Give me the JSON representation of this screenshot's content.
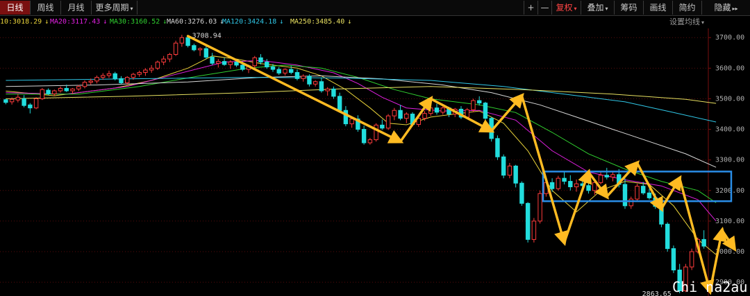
{
  "toolbar": {
    "tabs": [
      "日线",
      "周线",
      "月线",
      "更多周期"
    ],
    "right_buttons": [
      "+",
      "—",
      "复权",
      "叠加",
      "筹码",
      "画线",
      "简约",
      "隐藏"
    ]
  },
  "ma_bar": {
    "items": [
      {
        "label": "10:3018.29",
        "color": "#e8d23a"
      },
      {
        "label": "MA20:3117.43",
        "color": "#e020e0"
      },
      {
        "label": "MA30:3160.52",
        "color": "#30d030"
      },
      {
        "label": "MA60:3276.03",
        "color": "#d8d8d8"
      },
      {
        "label": "MA120:3424.18",
        "color": "#30c8e8"
      },
      {
        "label": "MA250:3485.40",
        "color": "#e8e060"
      }
    ],
    "settings_label": "设置均线"
  },
  "annotations": {
    "high_label": "3708.94",
    "low_label": "2863.65",
    "watermark": "Chi na2au"
  },
  "colors": {
    "up": "#ff3c3c",
    "down": "#22dddd",
    "arrow": "#ffbb22",
    "box": "#2a8ee8"
  },
  "chart_data": {
    "type": "candlestick",
    "y_ticks": [
      2900,
      3000,
      3100,
      3200,
      3300,
      3400,
      3500,
      3600,
      3700
    ],
    "ylim": [
      2855,
      3730
    ],
    "grid": true,
    "highest": 3708.94,
    "lowest": 2863.65,
    "ohlc": [
      [
        3497,
        3500,
        3482,
        3488
      ],
      [
        3490,
        3504,
        3481,
        3498
      ],
      [
        3496,
        3515,
        3488,
        3505
      ],
      [
        3500,
        3512,
        3472,
        3478
      ],
      [
        3480,
        3486,
        3452,
        3470
      ],
      [
        3470,
        3505,
        3466,
        3500
      ],
      [
        3500,
        3535,
        3496,
        3530
      ],
      [
        3528,
        3534,
        3512,
        3516
      ],
      [
        3516,
        3530,
        3510,
        3526
      ],
      [
        3526,
        3540,
        3520,
        3534
      ],
      [
        3534,
        3546,
        3522,
        3526
      ],
      [
        3526,
        3535,
        3516,
        3532
      ],
      [
        3532,
        3545,
        3525,
        3540
      ],
      [
        3540,
        3560,
        3534,
        3554
      ],
      [
        3554,
        3566,
        3546,
        3558
      ],
      [
        3558,
        3576,
        3550,
        3570
      ],
      [
        3570,
        3584,
        3562,
        3576
      ],
      [
        3576,
        3592,
        3568,
        3582
      ],
      [
        3582,
        3588,
        3560,
        3566
      ],
      [
        3566,
        3574,
        3548,
        3552
      ],
      [
        3552,
        3574,
        3546,
        3570
      ],
      [
        3570,
        3585,
        3562,
        3580
      ],
      [
        3580,
        3592,
        3572,
        3586
      ],
      [
        3586,
        3600,
        3575,
        3594
      ],
      [
        3594,
        3610,
        3585,
        3600
      ],
      [
        3600,
        3625,
        3594,
        3620
      ],
      [
        3620,
        3640,
        3610,
        3630
      ],
      [
        3630,
        3650,
        3620,
        3645
      ],
      [
        3645,
        3690,
        3640,
        3682
      ],
      [
        3682,
        3709,
        3670,
        3700
      ],
      [
        3700,
        3708,
        3668,
        3674
      ],
      [
        3674,
        3680,
        3655,
        3660
      ],
      [
        3660,
        3668,
        3640,
        3664
      ],
      [
        3664,
        3672,
        3630,
        3636
      ],
      [
        3636,
        3650,
        3610,
        3616
      ],
      [
        3616,
        3630,
        3602,
        3622
      ],
      [
        3622,
        3634,
        3608,
        3612
      ],
      [
        3612,
        3626,
        3598,
        3620
      ],
      [
        3620,
        3630,
        3604,
        3610
      ],
      [
        3610,
        3622,
        3590,
        3596
      ],
      [
        3596,
        3612,
        3584,
        3608
      ],
      [
        3608,
        3640,
        3600,
        3634
      ],
      [
        3634,
        3646,
        3612,
        3620
      ],
      [
        3620,
        3630,
        3598,
        3604
      ],
      [
        3604,
        3614,
        3588,
        3596
      ],
      [
        3596,
        3604,
        3578,
        3584
      ],
      [
        3584,
        3600,
        3576,
        3596
      ],
      [
        3596,
        3608,
        3580,
        3586
      ],
      [
        3586,
        3596,
        3560,
        3566
      ],
      [
        3566,
        3580,
        3556,
        3574
      ],
      [
        3574,
        3580,
        3540,
        3548
      ],
      [
        3548,
        3560,
        3540,
        3556
      ],
      [
        3556,
        3570,
        3520,
        3526
      ],
      [
        3526,
        3538,
        3510,
        3532
      ],
      [
        3532,
        3540,
        3500,
        3508
      ],
      [
        3508,
        3520,
        3455,
        3462
      ],
      [
        3462,
        3476,
        3410,
        3418
      ],
      [
        3418,
        3440,
        3405,
        3434
      ],
      [
        3434,
        3446,
        3392,
        3400
      ],
      [
        3400,
        3412,
        3350,
        3356
      ],
      [
        3356,
        3372,
        3350,
        3366
      ],
      [
        3366,
        3420,
        3360,
        3414
      ],
      [
        3414,
        3432,
        3398,
        3404
      ],
      [
        3404,
        3450,
        3398,
        3444
      ],
      [
        3444,
        3470,
        3430,
        3462
      ],
      [
        3462,
        3480,
        3430,
        3436
      ],
      [
        3436,
        3456,
        3420,
        3450
      ],
      [
        3450,
        3456,
        3410,
        3416
      ],
      [
        3416,
        3440,
        3408,
        3436
      ],
      [
        3436,
        3460,
        3428,
        3452
      ],
      [
        3452,
        3476,
        3444,
        3470
      ],
      [
        3470,
        3484,
        3448,
        3456
      ],
      [
        3456,
        3476,
        3448,
        3470
      ],
      [
        3470,
        3474,
        3440,
        3450
      ],
      [
        3450,
        3470,
        3440,
        3466
      ],
      [
        3466,
        3476,
        3434,
        3440
      ],
      [
        3440,
        3470,
        3434,
        3464
      ],
      [
        3464,
        3500,
        3456,
        3494
      ],
      [
        3494,
        3508,
        3478,
        3486
      ],
      [
        3486,
        3490,
        3430,
        3436
      ],
      [
        3436,
        3440,
        3360,
        3370
      ],
      [
        3370,
        3380,
        3300,
        3310
      ],
      [
        3310,
        3318,
        3240,
        3250
      ],
      [
        3250,
        3290,
        3240,
        3280
      ],
      [
        3280,
        3284,
        3210,
        3224
      ],
      [
        3224,
        3230,
        3150,
        3158
      ],
      [
        3158,
        3162,
        3030,
        3040
      ],
      [
        3040,
        3110,
        3030,
        3100
      ],
      [
        3100,
        3200,
        3092,
        3190
      ],
      [
        3190,
        3236,
        3180,
        3226
      ],
      [
        3226,
        3240,
        3196,
        3206
      ],
      [
        3206,
        3248,
        3200,
        3240
      ],
      [
        3240,
        3262,
        3220,
        3230
      ],
      [
        3230,
        3250,
        3200,
        3212
      ],
      [
        3212,
        3236,
        3196,
        3222
      ],
      [
        3222,
        3246,
        3206,
        3216
      ],
      [
        3216,
        3240,
        3190,
        3200
      ],
      [
        3200,
        3234,
        3186,
        3226
      ],
      [
        3226,
        3262,
        3220,
        3250
      ],
      [
        3250,
        3274,
        3236,
        3244
      ],
      [
        3244,
        3262,
        3230,
        3252
      ],
      [
        3252,
        3270,
        3210,
        3220
      ],
      [
        3220,
        3240,
        3140,
        3150
      ],
      [
        3150,
        3180,
        3140,
        3172
      ],
      [
        3172,
        3222,
        3166,
        3214
      ],
      [
        3214,
        3228,
        3186,
        3192
      ],
      [
        3192,
        3206,
        3170,
        3176
      ],
      [
        3176,
        3190,
        3140,
        3148
      ],
      [
        3148,
        3156,
        3080,
        3090
      ],
      [
        3090,
        3096,
        3000,
        3010
      ],
      [
        3010,
        3020,
        2930,
        2940
      ],
      [
        2940,
        2960,
        2864,
        2872
      ],
      [
        2872,
        2960,
        2868,
        2950
      ],
      [
        2950,
        3010,
        2940,
        3000
      ],
      [
        3000,
        3046,
        2994,
        3040
      ],
      [
        3040,
        3070,
        3010,
        3018
      ]
    ],
    "series": [
      {
        "name": "MA10",
        "color": "#e8d23a",
        "points": [
          [
            3525,
            0
          ],
          [
            3510,
            8
          ],
          [
            3535,
            18
          ],
          [
            3560,
            24
          ],
          [
            3600,
            30
          ],
          [
            3640,
            34
          ],
          [
            3630,
            38
          ],
          [
            3615,
            42
          ],
          [
            3600,
            48
          ],
          [
            3575,
            52
          ],
          [
            3530,
            56
          ],
          [
            3470,
            60
          ],
          [
            3420,
            63
          ],
          [
            3415,
            66
          ],
          [
            3440,
            70
          ],
          [
            3450,
            74
          ],
          [
            3460,
            78
          ],
          [
            3420,
            82
          ],
          [
            3330,
            86
          ],
          [
            3200,
            90
          ],
          [
            3130,
            94
          ],
          [
            3200,
            98
          ],
          [
            3230,
            102
          ],
          [
            3220,
            106
          ],
          [
            3150,
            110
          ],
          [
            3040,
            114
          ],
          [
            2990,
            117
          ]
        ]
      },
      {
        "name": "MA20",
        "color": "#e020e0",
        "points": [
          [
            3520,
            0
          ],
          [
            3515,
            10
          ],
          [
            3540,
            20
          ],
          [
            3580,
            28
          ],
          [
            3620,
            36
          ],
          [
            3625,
            42
          ],
          [
            3610,
            48
          ],
          [
            3585,
            54
          ],
          [
            3550,
            58
          ],
          [
            3505,
            62
          ],
          [
            3470,
            66
          ],
          [
            3460,
            72
          ],
          [
            3462,
            78
          ],
          [
            3430,
            84
          ],
          [
            3330,
            90
          ],
          [
            3260,
            96
          ],
          [
            3235,
            102
          ],
          [
            3215,
            108
          ],
          [
            3170,
            114
          ],
          [
            3100,
            117
          ]
        ]
      },
      {
        "name": "MA30",
        "color": "#30d030",
        "points": [
          [
            3515,
            0
          ],
          [
            3515,
            12
          ],
          [
            3540,
            22
          ],
          [
            3575,
            32
          ],
          [
            3600,
            40
          ],
          [
            3610,
            46
          ],
          [
            3600,
            52
          ],
          [
            3570,
            58
          ],
          [
            3530,
            64
          ],
          [
            3500,
            70
          ],
          [
            3480,
            78
          ],
          [
            3455,
            84
          ],
          [
            3390,
            90
          ],
          [
            3320,
            96
          ],
          [
            3270,
            102
          ],
          [
            3230,
            108
          ],
          [
            3200,
            114
          ],
          [
            3160,
            117
          ]
        ]
      },
      {
        "name": "MA60",
        "color": "#d8d8d8",
        "points": [
          [
            3540,
            0
          ],
          [
            3545,
            15
          ],
          [
            3555,
            30
          ],
          [
            3570,
            42
          ],
          [
            3575,
            52
          ],
          [
            3565,
            62
          ],
          [
            3545,
            72
          ],
          [
            3520,
            80
          ],
          [
            3480,
            88
          ],
          [
            3440,
            94
          ],
          [
            3400,
            100
          ],
          [
            3360,
            106
          ],
          [
            3320,
            112
          ],
          [
            3276,
            117
          ]
        ]
      },
      {
        "name": "MA120",
        "color": "#30c8e8",
        "points": [
          [
            3560,
            0
          ],
          [
            3565,
            20
          ],
          [
            3570,
            40
          ],
          [
            3568,
            55
          ],
          [
            3560,
            70
          ],
          [
            3540,
            82
          ],
          [
            3515,
            92
          ],
          [
            3490,
            102
          ],
          [
            3455,
            110
          ],
          [
            3424,
            117
          ]
        ]
      },
      {
        "name": "MA250",
        "color": "#e8e060",
        "points": [
          [
            3500,
            0
          ],
          [
            3508,
            20
          ],
          [
            3520,
            40
          ],
          [
            3532,
            55
          ],
          [
            3540,
            70
          ],
          [
            3530,
            85
          ],
          [
            3515,
            100
          ],
          [
            3498,
            112
          ],
          [
            3485,
            117
          ]
        ]
      }
    ],
    "trend_arrows": [
      [
        [
          3705,
          30
        ],
        [
          3360,
          65
        ]
      ],
      [
        [
          3360,
          65
        ],
        [
          3500,
          70
        ]
      ],
      [
        [
          3500,
          70
        ],
        [
          3395,
          80
        ]
      ],
      [
        [
          3395,
          80
        ],
        [
          3510,
          85
        ]
      ],
      [
        [
          3510,
          85
        ],
        [
          3030,
          92
        ]
      ],
      [
        [
          3030,
          92
        ],
        [
          3260,
          96
        ]
      ],
      [
        [
          3260,
          96
        ],
        [
          3180,
          99
        ]
      ],
      [
        [
          3180,
          99
        ],
        [
          3290,
          104
        ]
      ],
      [
        [
          3290,
          104
        ],
        [
          3140,
          108
        ]
      ],
      [
        [
          3140,
          108
        ],
        [
          3240,
          111
        ]
      ],
      [
        [
          3240,
          111
        ],
        [
          2870,
          116
        ]
      ],
      [
        [
          2870,
          116
        ],
        [
          3070,
          118
        ]
      ],
      [
        [
          3070,
          118
        ],
        [
          3010,
          120
        ]
      ]
    ],
    "highlight_box": {
      "y_top": 3262,
      "y_bottom": 3165,
      "x_from": 88.5,
      "x_to": 119.5
    }
  }
}
